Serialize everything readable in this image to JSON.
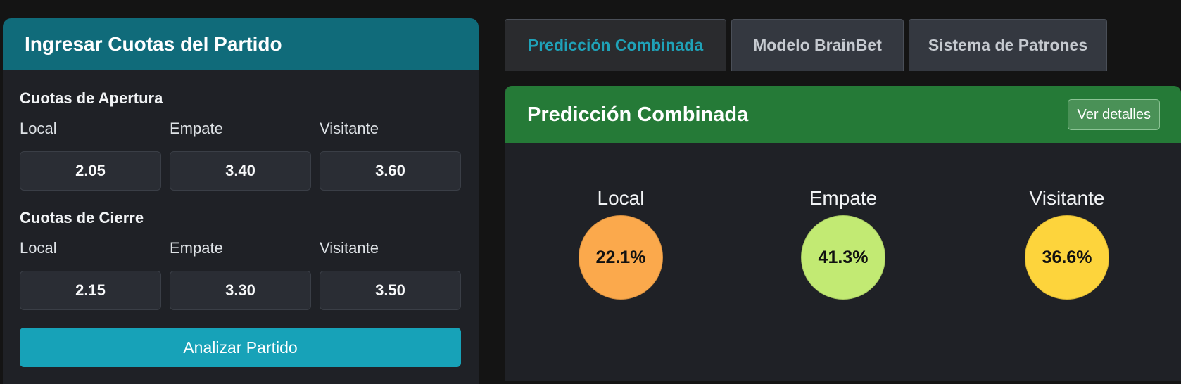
{
  "input_card": {
    "title": "Ingresar Cuotas del Partido",
    "opening": {
      "title": "Cuotas de Apertura",
      "labels": [
        "Local",
        "Empate",
        "Visitante"
      ],
      "values": [
        "2.05",
        "3.40",
        "3.60"
      ]
    },
    "closing": {
      "title": "Cuotas de Cierre",
      "labels": [
        "Local",
        "Empate",
        "Visitante"
      ],
      "values": [
        "2.15",
        "3.30",
        "3.50"
      ]
    },
    "analyze_label": "Analizar Partido"
  },
  "tabs": [
    {
      "label": "Predicción Combinada",
      "active": true
    },
    {
      "label": "Modelo BrainBet",
      "active": false
    },
    {
      "label": "Sistema de Patrones",
      "active": false
    }
  ],
  "prediction": {
    "title": "Predicción Combinada",
    "details_label": "Ver detalles",
    "outcomes": [
      {
        "label": "Local",
        "value": "22.1%",
        "color": "#fba94c"
      },
      {
        "label": "Empate",
        "value": "41.3%",
        "color": "#c2ea73"
      },
      {
        "label": "Visitante",
        "value": "36.6%",
        "color": "#fdd43c"
      }
    ]
  },
  "colors": {
    "input_header": "#106b7a",
    "prediction_header": "#257a37",
    "accent": "#17a2b8"
  }
}
